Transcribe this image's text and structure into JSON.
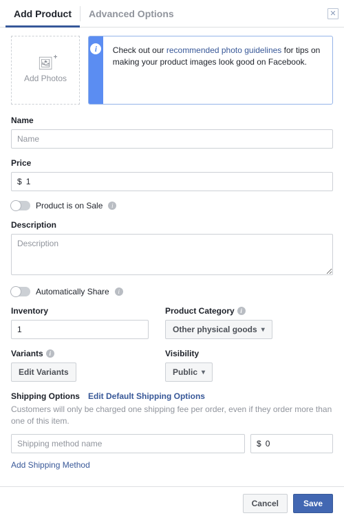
{
  "tabs": {
    "add": "Add Product",
    "advanced": "Advanced Options"
  },
  "photo_box": {
    "label": "Add Photos"
  },
  "tip": {
    "prefix": "Check out our ",
    "link": "recommended photo guidelines",
    "suffix": " for tips on making your product images look good on Facebook."
  },
  "labels": {
    "name": "Name",
    "price": "Price",
    "on_sale": "Product is on Sale",
    "description": "Description",
    "auto_share": "Automatically Share",
    "inventory": "Inventory",
    "category": "Product Category",
    "variants": "Variants",
    "visibility": "Visibility",
    "shipping": "Shipping Options",
    "shipping_edit_link": "Edit Default Shipping Options",
    "shipping_note": "Customers will only be charged one shipping fee per order, even if they order more than one of this item.",
    "add_shipping": "Add Shipping Method"
  },
  "placeholders": {
    "name": "Name",
    "description": "Description",
    "shipping_method": "Shipping method name"
  },
  "values": {
    "price_prefix": "$",
    "price": "1",
    "inventory": "1",
    "category": "Other physical goods",
    "edit_variants": "Edit Variants",
    "visibility": "Public",
    "ship_amount_prefix": "$",
    "ship_amount": "0"
  },
  "footer": {
    "cancel": "Cancel",
    "save": "Save"
  }
}
